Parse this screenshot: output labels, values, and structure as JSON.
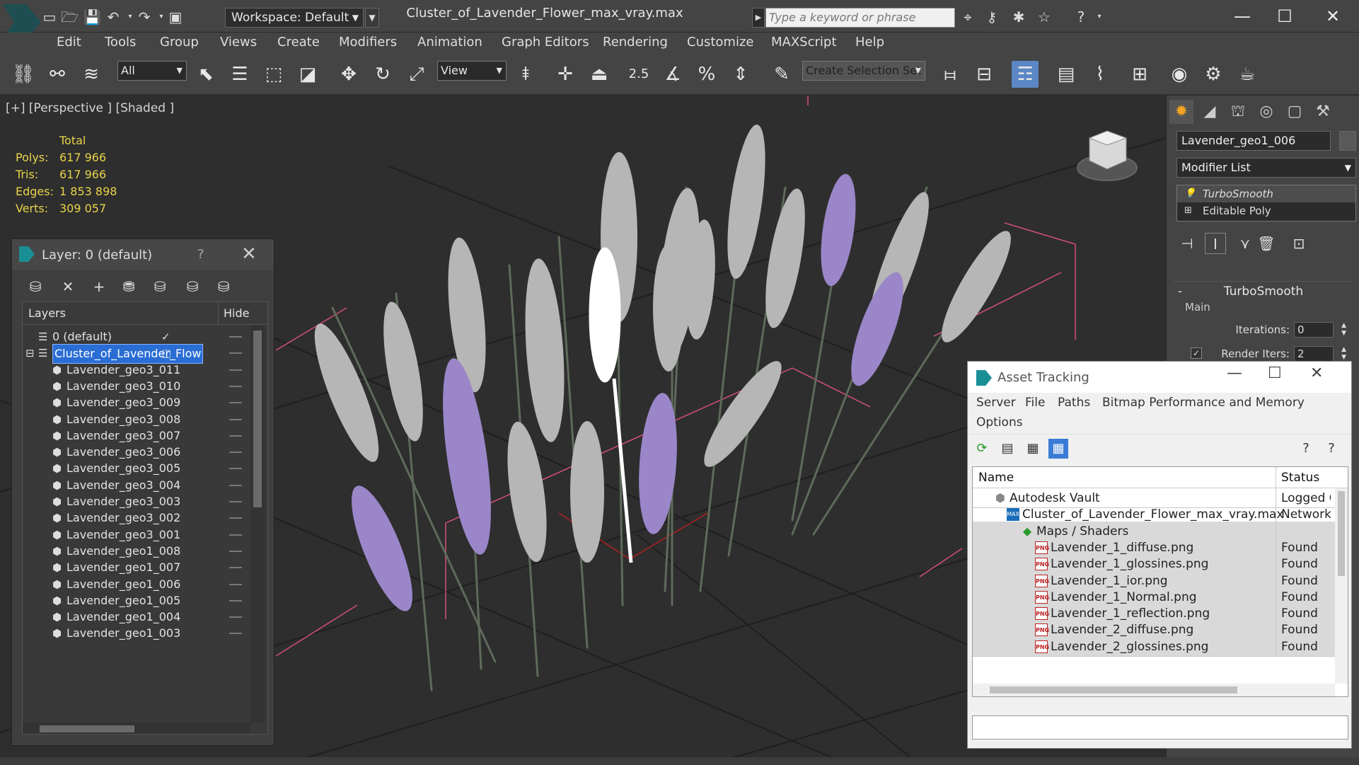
{
  "titlebar": {
    "workspace_label": "Workspace: Default",
    "document_title": "Cluster_of_Lavender_Flower_max_vray.max",
    "search_placeholder": "Type a keyword or phrase"
  },
  "menubar": {
    "items": [
      "Edit",
      "Tools",
      "Group",
      "Views",
      "Create",
      "Modifiers",
      "Animation",
      "Graph Editors",
      "Rendering",
      "Customize",
      "MAXScript",
      "Help"
    ]
  },
  "toolbar": {
    "selection_filter": "All",
    "reference_coord": "View",
    "snap_angle_label": "2.5",
    "named_selection": "Create Selection Set"
  },
  "viewport": {
    "label": "[+] [Perspective ] [Shaded ]",
    "stats": {
      "header": "Total",
      "rows": [
        {
          "key": "Polys:",
          "value": "617 966"
        },
        {
          "key": "Tris:",
          "value": "617 966"
        },
        {
          "key": "Edges:",
          "value": "1 853 898"
        },
        {
          "key": "Verts:",
          "value": "309 057"
        }
      ]
    }
  },
  "command_panel": {
    "object_name": "Lavender_geo1_006",
    "modifier_list": "Modifier List",
    "stack": [
      "TurboSmooth",
      "Editable Poly"
    ],
    "rollout_title": "TurboSmooth",
    "group_label": "Main",
    "iterations_label": "Iterations:",
    "iterations_value": "0",
    "render_iters_label": "Render Iters:",
    "render_iters_value": "2"
  },
  "layer_window": {
    "title": "Layer: 0 (default)",
    "help": "?",
    "col_layers": "Layers",
    "col_hide": "Hide",
    "rows": [
      {
        "name": "0 (default)",
        "level": 0,
        "check": "✓"
      },
      {
        "name": "Cluster_of_Lavender_Flow",
        "level": 0,
        "selected": true
      },
      {
        "name": "Lavender_geo3_011",
        "level": 1
      },
      {
        "name": "Lavender_geo3_010",
        "level": 1
      },
      {
        "name": "Lavender_geo3_009",
        "level": 1
      },
      {
        "name": "Lavender_geo3_008",
        "level": 1
      },
      {
        "name": "Lavender_geo3_007",
        "level": 1
      },
      {
        "name": "Lavender_geo3_006",
        "level": 1
      },
      {
        "name": "Lavender_geo3_005",
        "level": 1
      },
      {
        "name": "Lavender_geo3_004",
        "level": 1
      },
      {
        "name": "Lavender_geo3_003",
        "level": 1
      },
      {
        "name": "Lavender_geo3_002",
        "level": 1
      },
      {
        "name": "Lavender_geo3_001",
        "level": 1
      },
      {
        "name": "Lavender_geo1_008",
        "level": 1
      },
      {
        "name": "Lavender_geo1_007",
        "level": 1
      },
      {
        "name": "Lavender_geo1_006",
        "level": 1
      },
      {
        "name": "Lavender_geo1_005",
        "level": 1
      },
      {
        "name": "Lavender_geo1_004",
        "level": 1
      },
      {
        "name": "Lavender_geo1_003",
        "level": 1
      }
    ]
  },
  "asset_window": {
    "title": "Asset Tracking",
    "menu": [
      "Server",
      "File",
      "Paths",
      "Bitmap Performance and Memory",
      "Options"
    ],
    "col_name": "Name",
    "col_status": "Status",
    "rows": [
      {
        "name": "Autodesk Vault",
        "status": "Logged O",
        "icon": "vault",
        "level": 0
      },
      {
        "name": "Cluster_of_Lavender_Flower_max_vray.max",
        "status": "Network",
        "icon": "max",
        "level": 1
      },
      {
        "name": "Maps / Shaders",
        "status": "",
        "icon": "maps",
        "level": 2
      },
      {
        "name": "Lavender_1_diffuse.png",
        "status": "Found",
        "icon": "png",
        "level": 3
      },
      {
        "name": "Lavender_1_glossines.png",
        "status": "Found",
        "icon": "png",
        "level": 3
      },
      {
        "name": "Lavender_1_ior.png",
        "status": "Found",
        "icon": "png",
        "level": 3
      },
      {
        "name": "Lavender_1_Normal.png",
        "status": "Found",
        "icon": "png",
        "level": 3
      },
      {
        "name": "Lavender_1_reflection.png",
        "status": "Found",
        "icon": "png",
        "level": 3
      },
      {
        "name": "Lavender_2_diffuse.png",
        "status": "Found",
        "icon": "png",
        "level": 3
      },
      {
        "name": "Lavender_2_glossines.png",
        "status": "Found",
        "icon": "png",
        "level": 3
      }
    ]
  },
  "colors": {
    "ui_dark": "#444444",
    "viewport_bg": "#2e2e2e",
    "stats_yellow": "#e8d44a",
    "selection_blue": "#2a6dd4",
    "lavender": "#9a86c8",
    "gizmo_pink": "#d2507a"
  }
}
